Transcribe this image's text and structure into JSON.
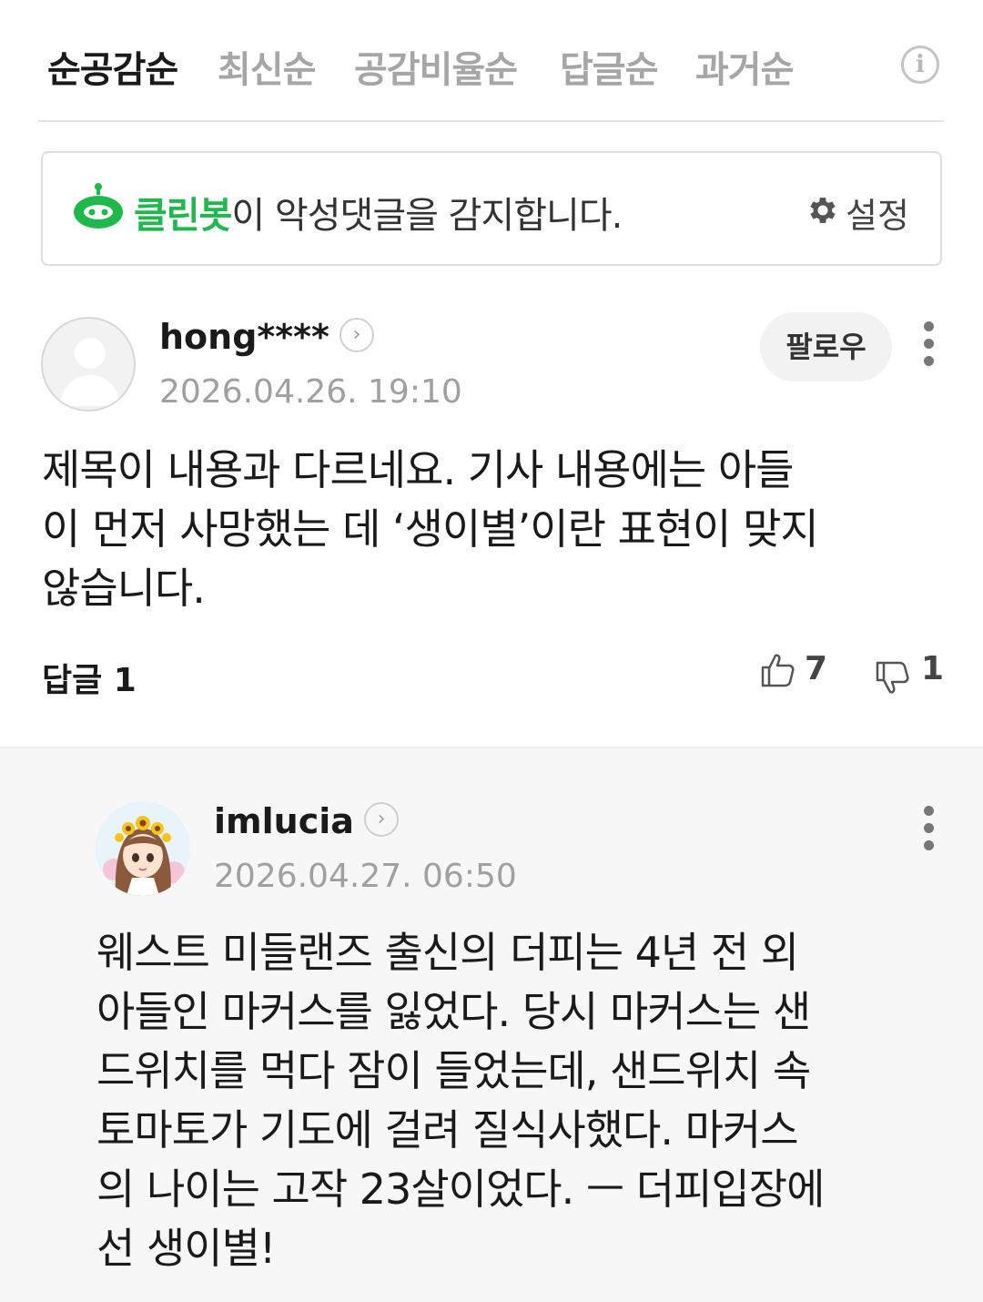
{
  "sort_tabs": [
    {
      "label": "순공감순",
      "active": true
    },
    {
      "label": "최신순",
      "active": false
    },
    {
      "label": "공감비율순",
      "active": false
    },
    {
      "label": "답글순",
      "active": false
    },
    {
      "label": "과거순",
      "active": false
    }
  ],
  "info_label": "i",
  "cleanbot": {
    "name": "클린봇",
    "message": "이 악성댓글을 감지합니다.",
    "settings_label": "설정",
    "color": "#1fb84d"
  },
  "comment": {
    "username": "hong****",
    "timestamp": "2026.04.26. 19:10",
    "follow_label": "팔로우",
    "lines": [
      "제목이 내용과 다르네요. 기사 내용에는 아들",
      "이 먼저 사망했는 데 ‘생이별’이란 표현이 맞지",
      "않습니다."
    ],
    "reply_label": "답글 1",
    "likes": "7",
    "dislikes": "1"
  },
  "reply": {
    "username": "imlucia",
    "timestamp": "2026.04.27. 06:50",
    "lines": [
      "웨스트 미들랜즈 출신의 더피는 4년 전 외",
      "아들인 마커스를 잃었다. 당시 마커스는 샌",
      "드위치를 먹다 잠이 들었는데, 샌드위치 속",
      "토마토가 기도에 걸려 질식사했다. 마커스",
      "의 나이는 고작 23살이었다. ㅡ 더피입장에",
      "선 생이별!"
    ]
  },
  "icons": {
    "profile_arrow": "chevron-right-icon",
    "more": "more-vertical-icon",
    "like": "thumbs-up-icon",
    "dislike": "thumbs-down-icon",
    "gear": "gear-icon",
    "bot": "cleanbot-icon"
  }
}
